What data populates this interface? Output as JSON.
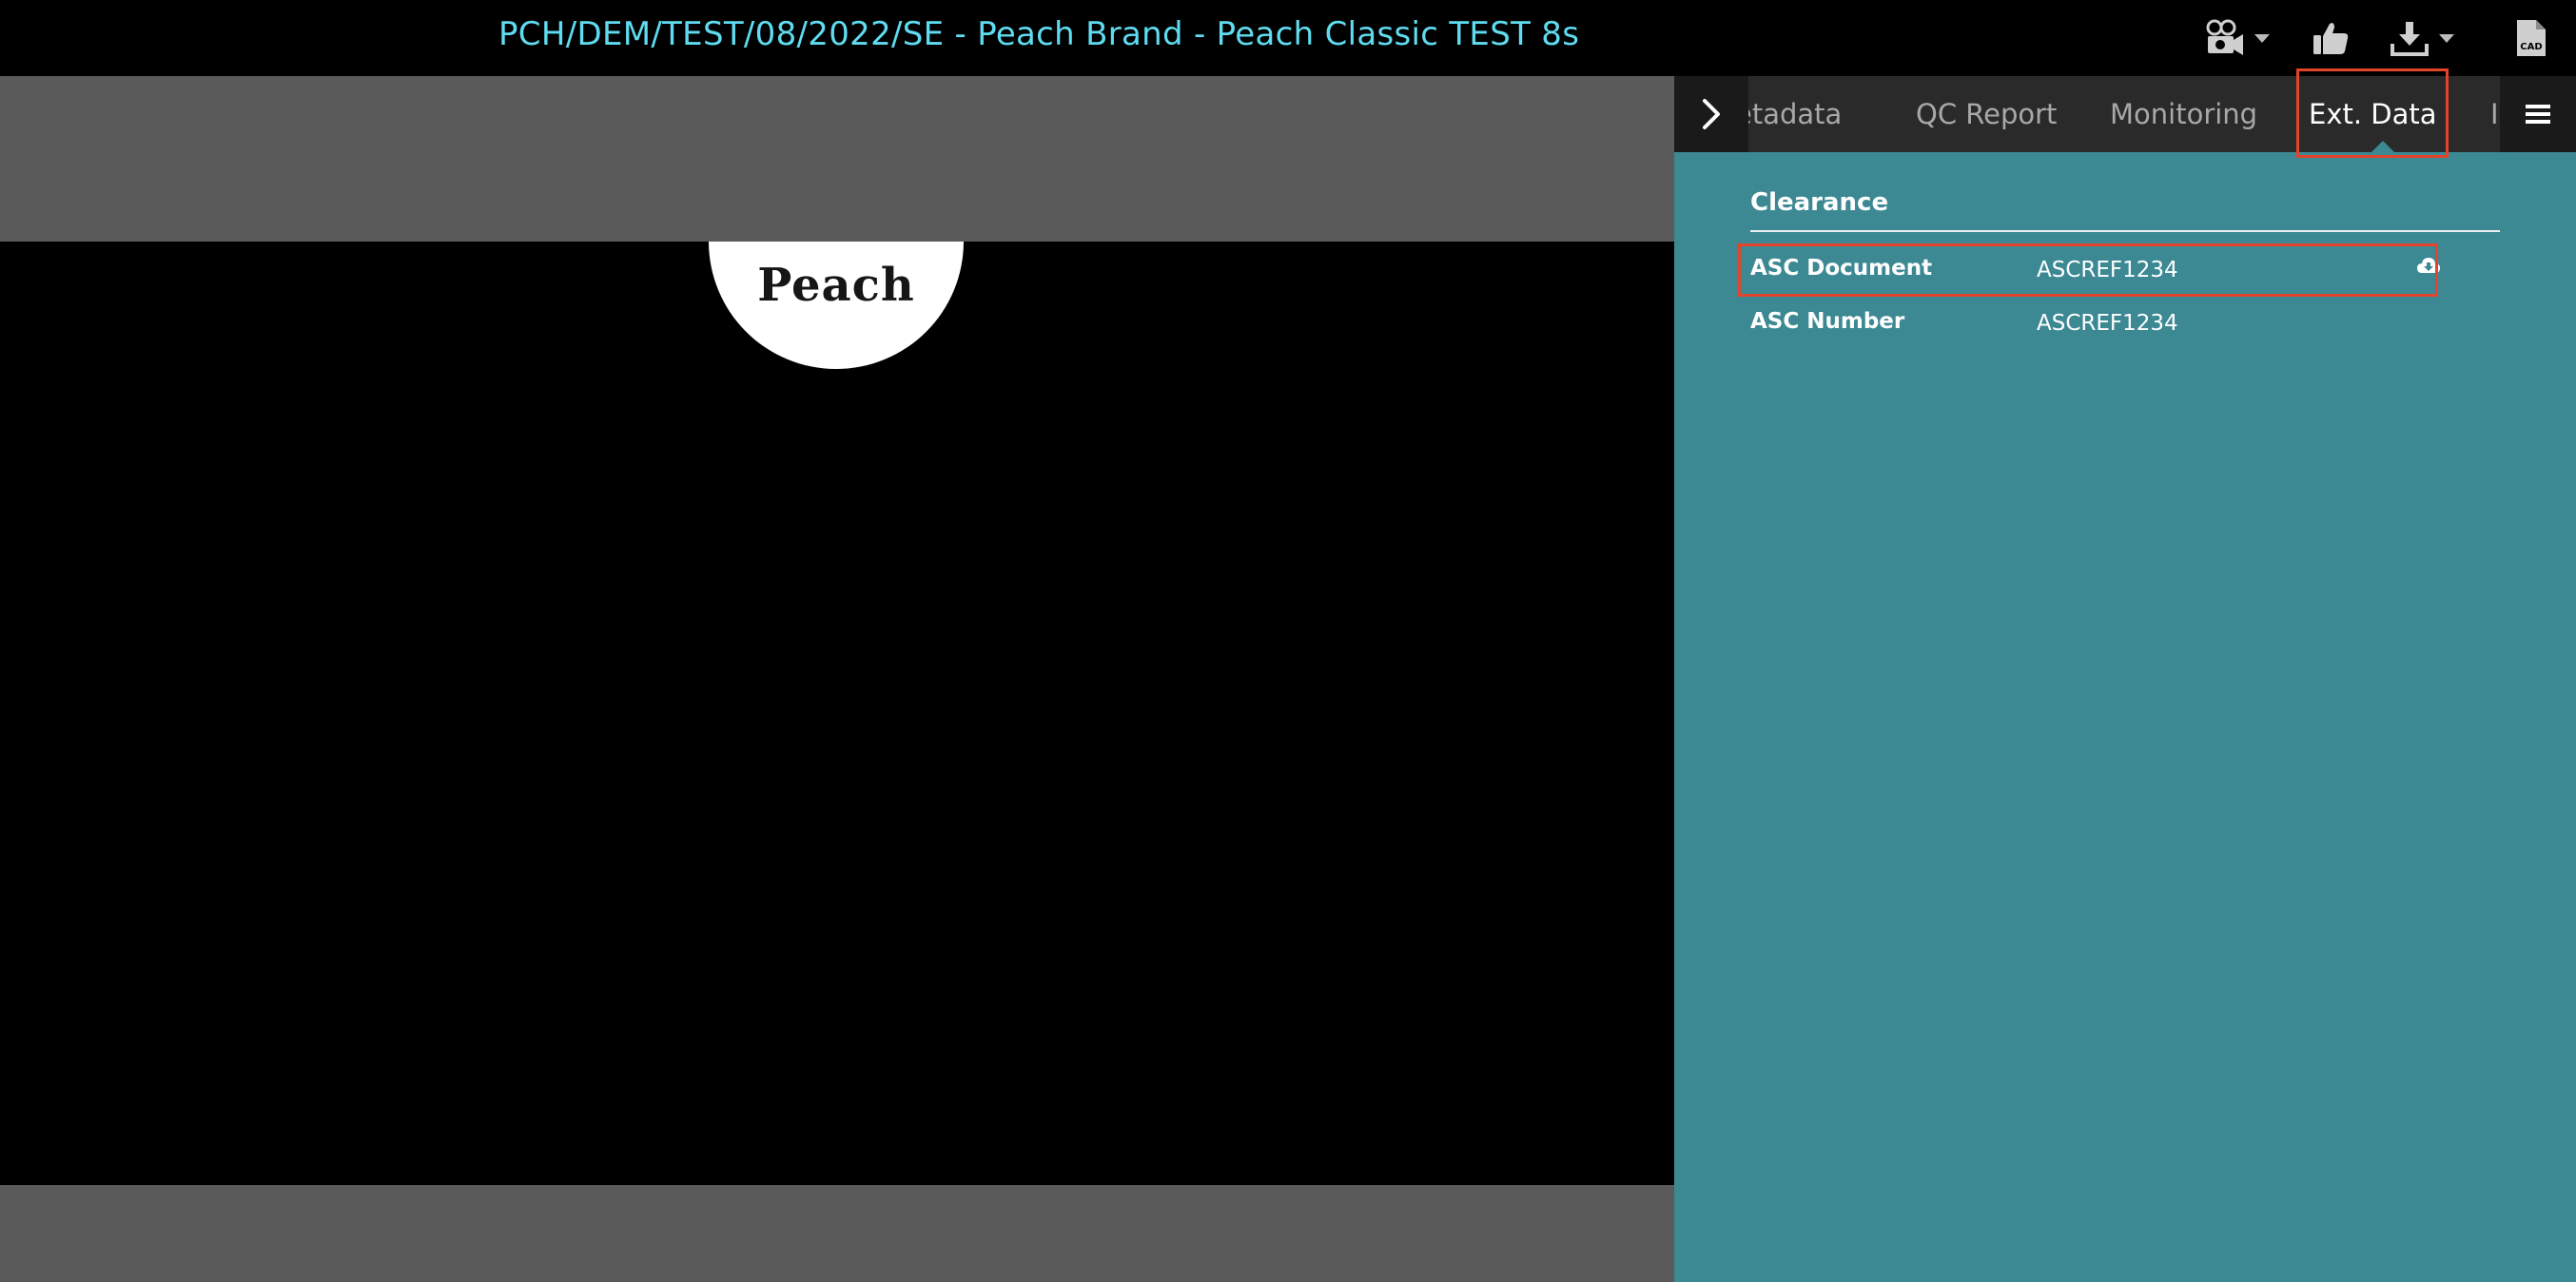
{
  "header": {
    "title": "PCH/DEM/TEST/08/2022/SE - Peach Brand - Peach Classic TEST 8s",
    "cad_label": "CAD"
  },
  "player": {
    "logo_text": "Peach"
  },
  "panel": {
    "tabs": [
      {
        "label": "Metadata",
        "visible_text": "etadata"
      },
      {
        "label": "QC Report"
      },
      {
        "label": "Monitoring"
      },
      {
        "label": "Ext. Data",
        "active": true
      },
      {
        "label": "I"
      }
    ],
    "section_title": "Clearance",
    "rows": [
      {
        "key": "ASC Document",
        "value": "ASCREF1234",
        "icon": "cloud-download-icon"
      },
      {
        "key": "ASC Number",
        "value": "ASCREF1234"
      }
    ]
  },
  "colors": {
    "title": "#5fdcf0",
    "panel_bg": "#3c8994",
    "highlight": "#e2432a",
    "grey_band": "#5a5a5a"
  }
}
